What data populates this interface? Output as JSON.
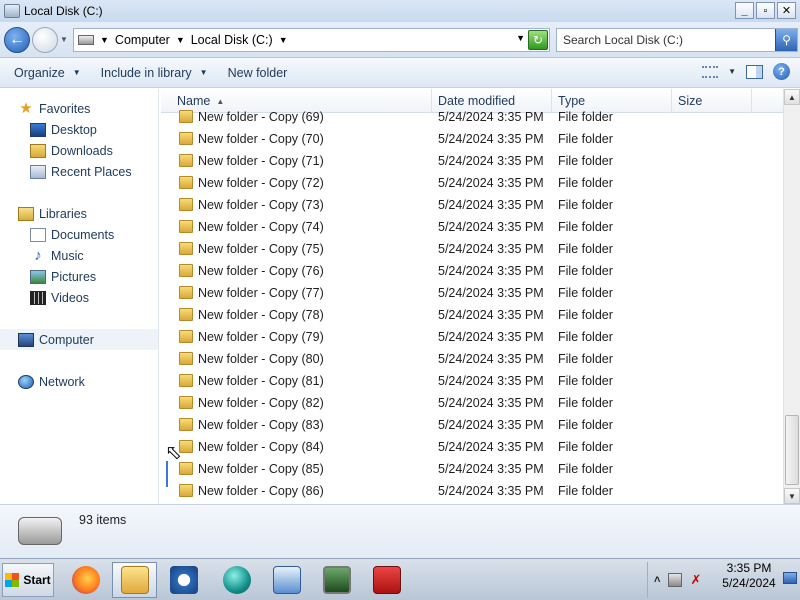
{
  "window": {
    "title": "Local Disk (C:)",
    "buttons": [
      "_",
      "▫",
      "✕"
    ]
  },
  "address": {
    "crumbs": [
      "Computer",
      "Local Disk (C:)"
    ],
    "search_placeholder": "Search Local Disk (C:)"
  },
  "toolbar": {
    "organize": "Organize",
    "include": "Include in library",
    "new_folder": "New folder"
  },
  "nav": {
    "favorites": "Favorites",
    "desktop": "Desktop",
    "downloads": "Downloads",
    "recent": "Recent Places",
    "libraries": "Libraries",
    "documents": "Documents",
    "music": "Music",
    "pictures": "Pictures",
    "videos": "Videos",
    "computer": "Computer",
    "network": "Network"
  },
  "columns": {
    "name": "Name",
    "date": "Date modified",
    "type": "Type",
    "size": "Size"
  },
  "rows": [
    {
      "name": "New folder - Copy (69)",
      "date": "5/24/2024 3:35 PM",
      "type": "File folder"
    },
    {
      "name": "New folder - Copy (70)",
      "date": "5/24/2024 3:35 PM",
      "type": "File folder"
    },
    {
      "name": "New folder - Copy (71)",
      "date": "5/24/2024 3:35 PM",
      "type": "File folder"
    },
    {
      "name": "New folder - Copy (72)",
      "date": "5/24/2024 3:35 PM",
      "type": "File folder"
    },
    {
      "name": "New folder - Copy (73)",
      "date": "5/24/2024 3:35 PM",
      "type": "File folder"
    },
    {
      "name": "New folder - Copy (74)",
      "date": "5/24/2024 3:35 PM",
      "type": "File folder"
    },
    {
      "name": "New folder - Copy (75)",
      "date": "5/24/2024 3:35 PM",
      "type": "File folder"
    },
    {
      "name": "New folder - Copy (76)",
      "date": "5/24/2024 3:35 PM",
      "type": "File folder"
    },
    {
      "name": "New folder - Copy (77)",
      "date": "5/24/2024 3:35 PM",
      "type": "File folder"
    },
    {
      "name": "New folder - Copy (78)",
      "date": "5/24/2024 3:35 PM",
      "type": "File folder"
    },
    {
      "name": "New folder - Copy (79)",
      "date": "5/24/2024 3:35 PM",
      "type": "File folder"
    },
    {
      "name": "New folder - Copy (80)",
      "date": "5/24/2024 3:35 PM",
      "type": "File folder"
    },
    {
      "name": "New folder - Copy (81)",
      "date": "5/24/2024 3:35 PM",
      "type": "File folder"
    },
    {
      "name": "New folder - Copy (82)",
      "date": "5/24/2024 3:35 PM",
      "type": "File folder"
    },
    {
      "name": "New folder - Copy (83)",
      "date": "5/24/2024 3:35 PM",
      "type": "File folder"
    },
    {
      "name": "New folder - Copy (84)",
      "date": "5/24/2024 3:35 PM",
      "type": "File folder"
    },
    {
      "name": "New folder - Copy (85)",
      "date": "5/24/2024 3:35 PM",
      "type": "File folder"
    },
    {
      "name": "New folder - Copy (86)",
      "date": "5/24/2024 3:35 PM",
      "type": "File folder"
    }
  ],
  "details": {
    "count": "93 items"
  },
  "taskbar": {
    "start": "Start",
    "time": "3:35 PM",
    "date": "5/24/2024",
    "apps": [
      "firefox-icon",
      "explorer-icon",
      "media-player-icon",
      "browser-globe-icon",
      "control-panel-icon",
      "system-monitor-icon",
      "toolbox-icon"
    ]
  }
}
